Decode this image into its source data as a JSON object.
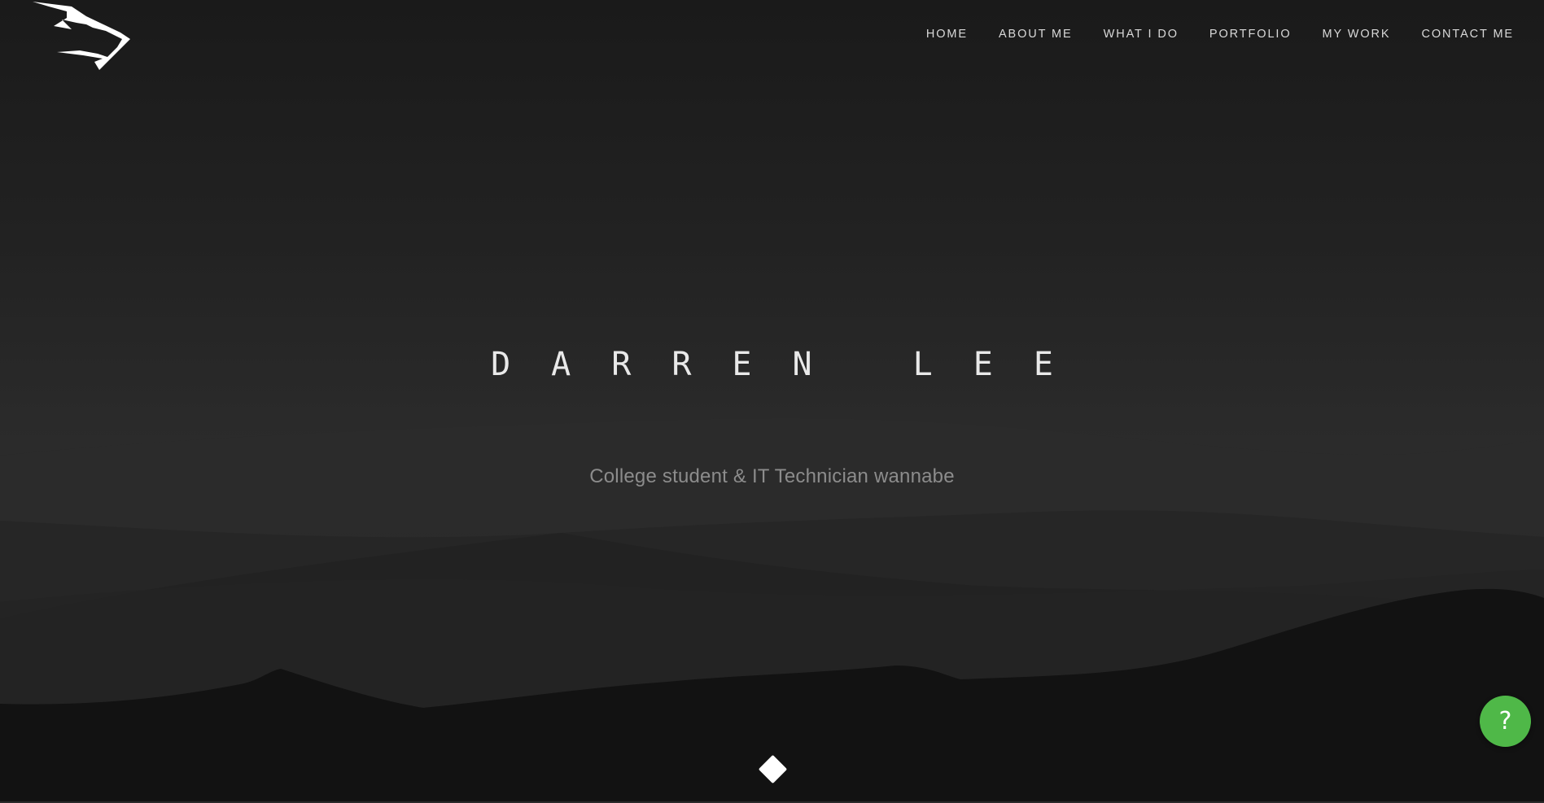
{
  "site": {
    "logo_icon": "bull-head-logo-icon"
  },
  "nav": {
    "items": [
      {
        "label": "HOME"
      },
      {
        "label": "ABOUT ME"
      },
      {
        "label": "WHAT I DO"
      },
      {
        "label": "PORTFOLIO"
      },
      {
        "label": "MY WORK"
      },
      {
        "label": "CONTACT ME"
      }
    ]
  },
  "hero": {
    "title": "DARREN LEE",
    "subtitle": "College student & IT Technician wannabe",
    "scroll_icon": "diamond-icon"
  },
  "help": {
    "label": "?",
    "color": "#4fb848"
  },
  "colors": {
    "background": "#1b1b1b",
    "text": "#e9e9e9",
    "subtitle": "#8c8c8c"
  }
}
